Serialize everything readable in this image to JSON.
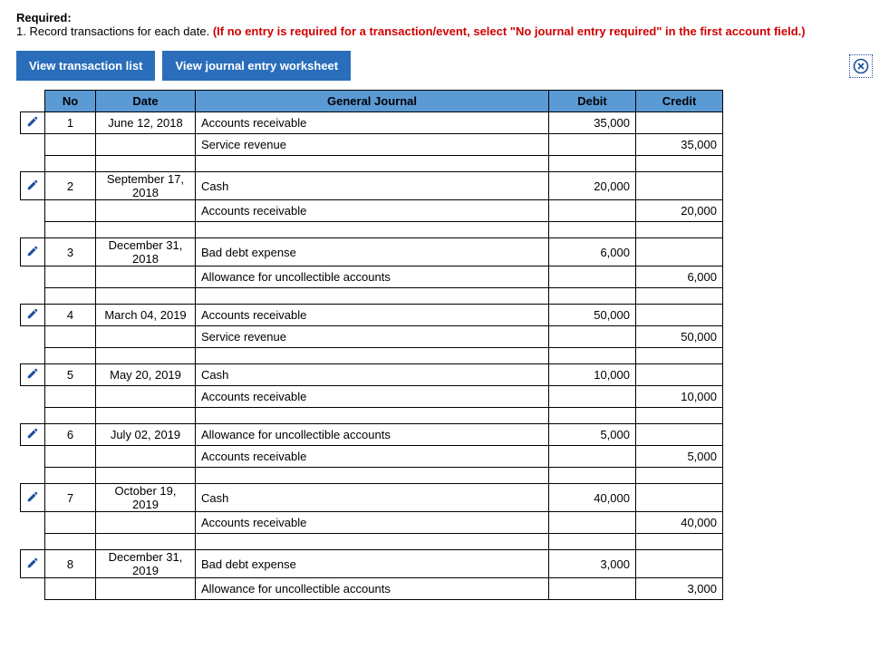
{
  "header": {
    "required": "Required:",
    "instruction_num": "1.",
    "instruction_text": "Record transactions for each date.",
    "note": "(If no entry is required for a transaction/event, select \"No journal entry required\" in the first account field.)"
  },
  "toolbar": {
    "view_list": "View transaction list",
    "view_worksheet": "View journal entry worksheet"
  },
  "columns": {
    "no": "No",
    "date": "Date",
    "gj": "General Journal",
    "debit": "Debit",
    "credit": "Credit"
  },
  "entries": [
    {
      "no": "1",
      "date": "June 12, 2018",
      "lines": [
        {
          "account": "Accounts receivable",
          "debit": "35,000",
          "credit": ""
        },
        {
          "account": "Service revenue",
          "debit": "",
          "credit": "35,000",
          "indent": true
        }
      ]
    },
    {
      "no": "2",
      "date": "September 17, 2018",
      "lines": [
        {
          "account": "Cash",
          "debit": "20,000",
          "credit": ""
        },
        {
          "account": "Accounts receivable",
          "debit": "",
          "credit": "20,000",
          "indent": true
        }
      ]
    },
    {
      "no": "3",
      "date": "December 31, 2018",
      "lines": [
        {
          "account": "Bad debt expense",
          "debit": "6,000",
          "credit": ""
        },
        {
          "account": "Allowance for uncollectible accounts",
          "debit": "",
          "credit": "6,000",
          "indent": true
        }
      ]
    },
    {
      "no": "4",
      "date": "March 04, 2019",
      "lines": [
        {
          "account": "Accounts receivable",
          "debit": "50,000",
          "credit": ""
        },
        {
          "account": "Service revenue",
          "debit": "",
          "credit": "50,000",
          "indent": true
        }
      ]
    },
    {
      "no": "5",
      "date": "May 20, 2019",
      "lines": [
        {
          "account": "Cash",
          "debit": "10,000",
          "credit": ""
        },
        {
          "account": "Accounts receivable",
          "debit": "",
          "credit": "10,000",
          "indent": true
        }
      ]
    },
    {
      "no": "6",
      "date": "July 02, 2019",
      "lines": [
        {
          "account": "Allowance for uncollectible accounts",
          "debit": "5,000",
          "credit": ""
        },
        {
          "account": "Accounts receivable",
          "debit": "",
          "credit": "5,000",
          "indent": true
        }
      ]
    },
    {
      "no": "7",
      "date": "October 19, 2019",
      "lines": [
        {
          "account": "Cash",
          "debit": "40,000",
          "credit": ""
        },
        {
          "account": "Accounts receivable",
          "debit": "",
          "credit": "40,000",
          "indent": true
        }
      ]
    },
    {
      "no": "8",
      "date": "December 31, 2019",
      "lines": [
        {
          "account": "Bad debt expense",
          "debit": "3,000",
          "credit": ""
        },
        {
          "account": "Allowance for uncollectible accounts",
          "debit": "",
          "credit": "3,000",
          "indent": true
        }
      ]
    }
  ],
  "chart_data": {
    "type": "table",
    "title": "General Journal",
    "columns": [
      "No",
      "Date",
      "General Journal",
      "Debit",
      "Credit"
    ],
    "rows": [
      [
        "1",
        "June 12, 2018",
        "Accounts receivable",
        "35,000",
        ""
      ],
      [
        "",
        "",
        "Service revenue",
        "",
        "35,000"
      ],
      [
        "2",
        "September 17, 2018",
        "Cash",
        "20,000",
        ""
      ],
      [
        "",
        "",
        "Accounts receivable",
        "",
        "20,000"
      ],
      [
        "3",
        "December 31, 2018",
        "Bad debt expense",
        "6,000",
        ""
      ],
      [
        "",
        "",
        "Allowance for uncollectible accounts",
        "",
        "6,000"
      ],
      [
        "4",
        "March 04, 2019",
        "Accounts receivable",
        "50,000",
        ""
      ],
      [
        "",
        "",
        "Service revenue",
        "",
        "50,000"
      ],
      [
        "5",
        "May 20, 2019",
        "Cash",
        "10,000",
        ""
      ],
      [
        "",
        "",
        "Accounts receivable",
        "",
        "10,000"
      ],
      [
        "6",
        "July 02, 2019",
        "Allowance for uncollectible accounts",
        "5,000",
        ""
      ],
      [
        "",
        "",
        "Accounts receivable",
        "",
        "5,000"
      ],
      [
        "7",
        "October 19, 2019",
        "Cash",
        "40,000",
        ""
      ],
      [
        "",
        "",
        "Accounts receivable",
        "",
        "40,000"
      ],
      [
        "8",
        "December 31, 2019",
        "Bad debt expense",
        "3,000",
        ""
      ],
      [
        "",
        "",
        "Allowance for uncollectible accounts",
        "",
        "3,000"
      ]
    ]
  }
}
